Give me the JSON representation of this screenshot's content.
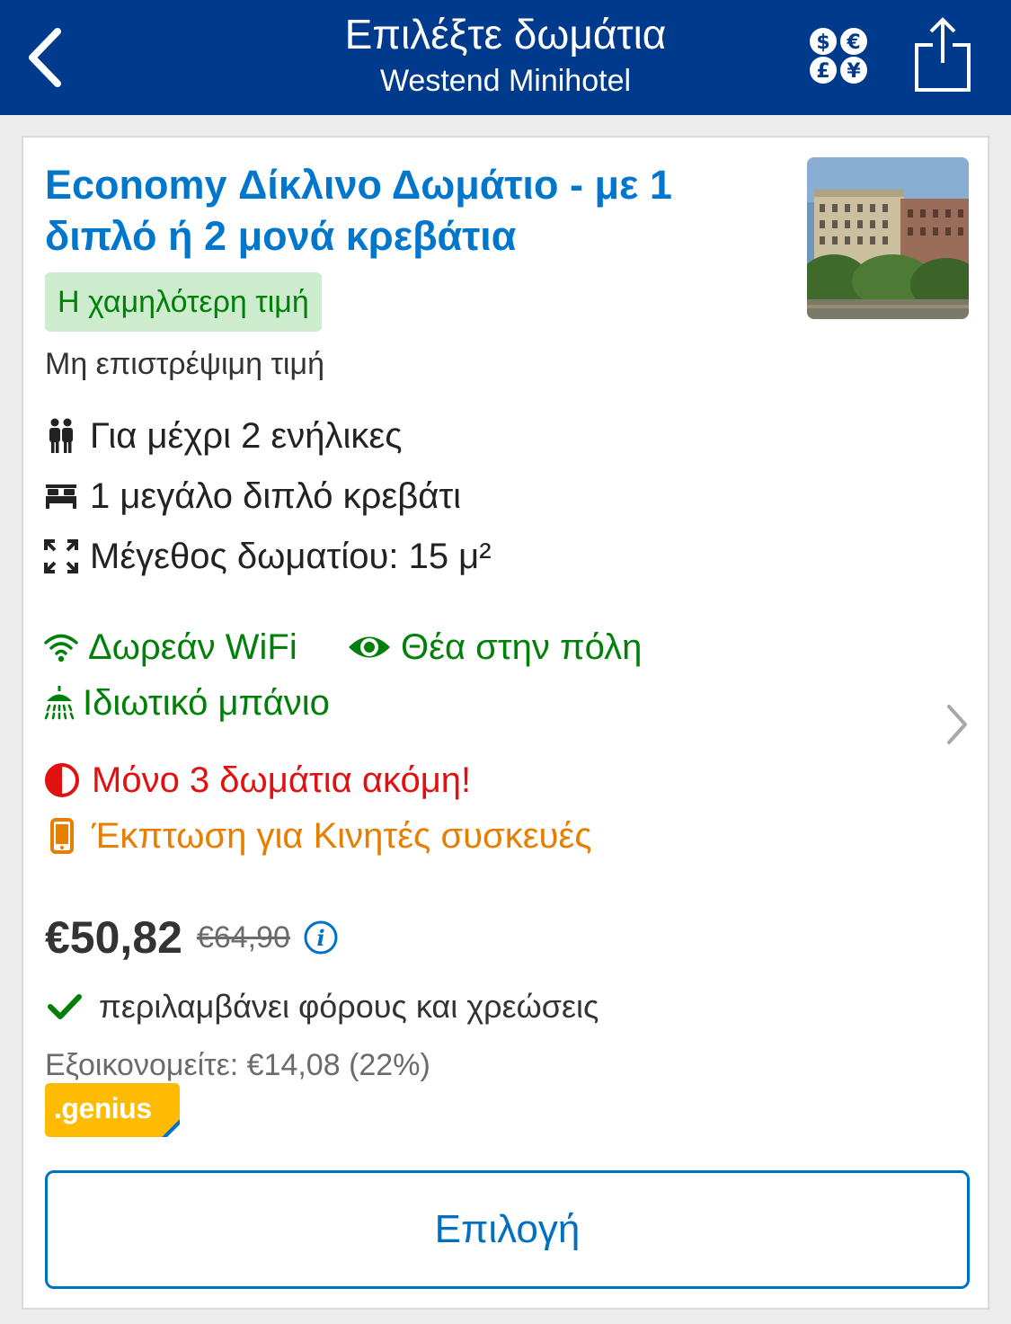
{
  "header": {
    "title": "Επιλέξτε δωμάτια",
    "subtitle": "Westend Minihotel",
    "back_icon": "chevron-left-icon",
    "currency_icon": "currency-exchange-icon",
    "share_icon": "share-icon"
  },
  "room": {
    "title": "Economy Δίκλινο Δωμάτιο - με 1 διπλό ή 2 μονά κρεβάτια",
    "badge": "Η χαμηλότερη τιμή",
    "refund_policy": "Μη επιστρέψιμη τιμή",
    "facts": [
      {
        "icon": "guests-icon",
        "text": "Για μέχρι 2 ενήλικες"
      },
      {
        "icon": "bed-icon",
        "text": "1 μεγάλο διπλό κρεβάτι"
      },
      {
        "icon": "room-size-icon",
        "text": "Μέγεθος δωματίου: 15 μ²"
      }
    ],
    "amenities": [
      {
        "icon": "wifi-icon",
        "text": "Δωρεάν WiFi"
      },
      {
        "icon": "eye-icon",
        "text": "Θέα στην πόλη"
      },
      {
        "icon": "shower-icon",
        "text": "Ιδιωτικό μπάνιο"
      }
    ],
    "availability": "Μόνο 3 δωμάτια ακόμη!",
    "mobile_discount": "Έκπτωση για Κινητές συσκευές",
    "price_current": "€50,82",
    "price_original": "€64,90",
    "taxes_note": "περιλαμβάνει φόρους και χρεώσεις",
    "savings": "Εξοικονομείτε: €14,08 (22%)",
    "genius_label": ".genius",
    "select_label": "Επιλογή"
  },
  "colors": {
    "header_bg": "#003a8c",
    "title_blue": "#0077cc",
    "green": "#008009",
    "red": "#e21111",
    "orange": "#e67e00",
    "genius_yellow": "#febb02",
    "button_blue": "#0071c2"
  }
}
